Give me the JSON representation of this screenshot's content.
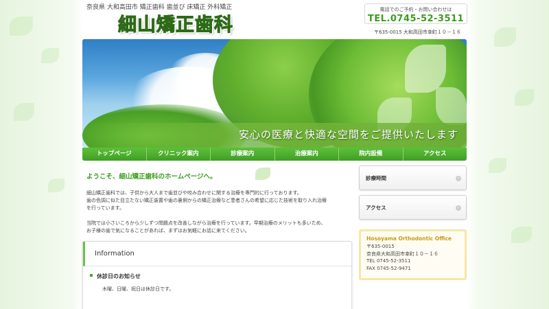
{
  "header": {
    "tagline": "奈良県 大和高田市 矯正歯科 歯並び 床矯正 外科矯正",
    "logo": "細山矯正歯科",
    "tel_caption": "電話でのご予約・お問い合わせは",
    "tel_number": "TEL.0745-52-3511",
    "address": "〒635-0015 大和高田市幸町１０－１６"
  },
  "hero": {
    "slogan": "安心の医療と快適な空間をご提供いたします"
  },
  "nav": {
    "items": [
      "トップページ",
      "クリニック案内",
      "診療案内",
      "治療案内",
      "院内設備",
      "アクセス"
    ]
  },
  "main": {
    "welcome_title": "ようこそ、細山矯正歯科のホームページへ。",
    "paragraph1_line1": "細山矯正歯科では、子供から大人まで歯並びや咬み合わせに関する治療を専門的に行っております。",
    "paragraph1_line2": "歯の色調に似た目立たない矯正装置や歯の裏側からの矯正治療など患者さんの希望に応じた技術を取り入れ治療",
    "paragraph1_line3": "を行っています。",
    "paragraph2_line1": "当院では小さいころから少しずつ問題点を改善しながら治療を行っています。早期治療のメリットも多いため、",
    "paragraph2_line2": "お子様の歯で気になることがあれば、まずはお気軽にお話に来てください。"
  },
  "information": {
    "heading": "Information",
    "news_title": "休診日のお知らせ",
    "news_body": "木曜、日曜、祝日は休診日です。"
  },
  "sidebar": {
    "hours_label": "診療時間",
    "access_label": "アクセス",
    "arrow_glyph": "›",
    "office": {
      "name": "Hosoyama Orthodontic Office",
      "postal": "〒635-0015",
      "address": "奈良県大和高田市幸町１０－１６",
      "tel": "TEL 0745-52-3511",
      "fax": "FAX 0745-52-9471"
    }
  },
  "colors": {
    "brand_green": "#3a9d1c",
    "nav_green": "#4fb02e",
    "office_gold": "#c99a12"
  }
}
